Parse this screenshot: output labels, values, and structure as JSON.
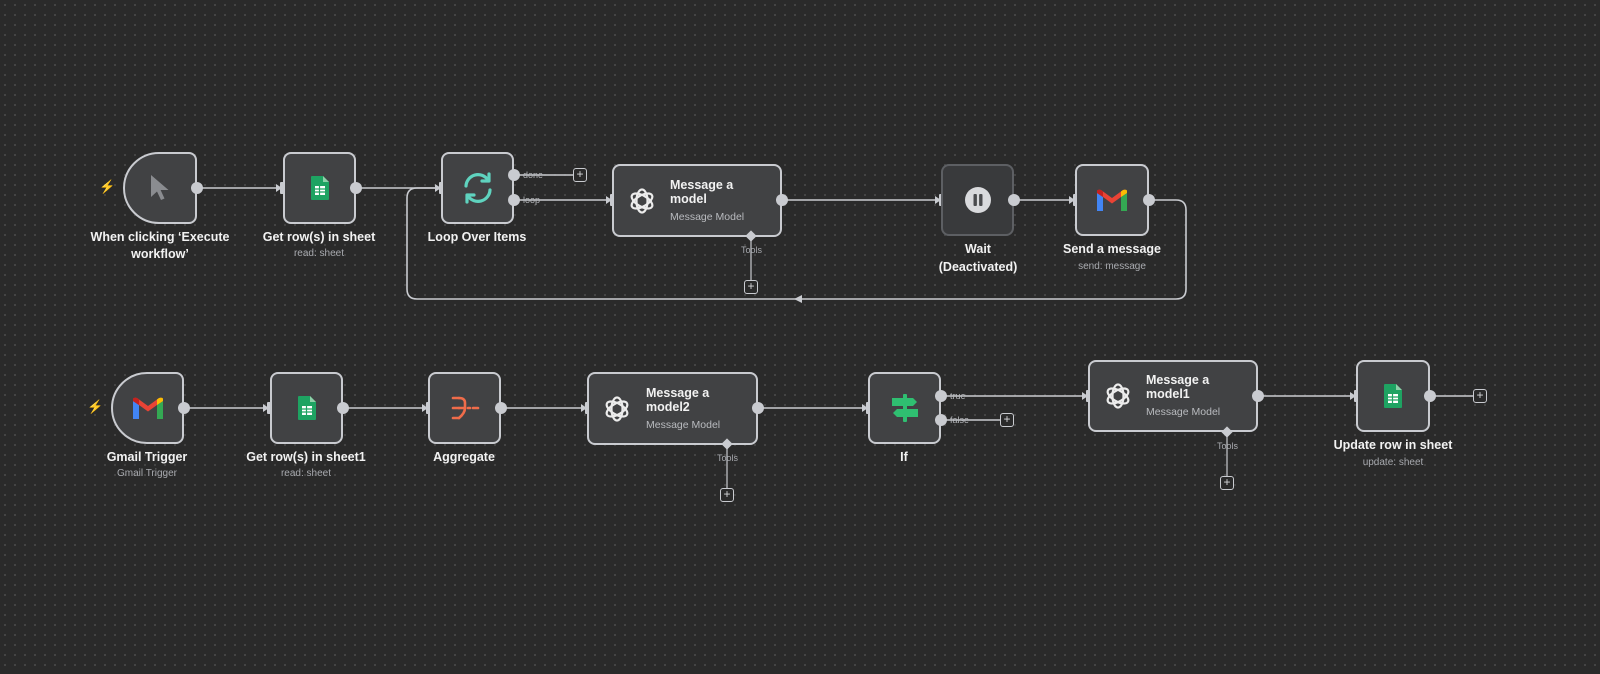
{
  "colors": {
    "canvas": "#2a2a2a",
    "node_fill": "#414244",
    "node_border": "#c9cbd0",
    "sheets_green": "#0f9d58",
    "loop_teal": "#5fd3bf",
    "aggregate_orange": "#ef6c4a",
    "if_green": "#2fbf71",
    "trigger_red": "#f0564a"
  },
  "workflow1": {
    "trigger": {
      "label": "When clicking ‘Execute workflow’",
      "icon": "cursor-pointer-icon"
    },
    "get_rows": {
      "label": "Get row(s) in sheet",
      "sublabel": "read: sheet",
      "icon": "google-sheets-icon"
    },
    "loop": {
      "label": "Loop Over Items",
      "icon": "loop-arrows-icon",
      "out_done": "done",
      "out_loop": "loop"
    },
    "message_model": {
      "title": "Message a model",
      "subtitle": "Message Model",
      "tools": "Tools",
      "icon": "openai-icon"
    },
    "wait": {
      "label_line1": "Wait",
      "label_line2": "(Deactivated)",
      "icon": "pause-icon"
    },
    "send_message": {
      "label": "Send a message",
      "sublabel": "send: message",
      "icon": "gmail-icon"
    }
  },
  "workflow2": {
    "gmail_trigger": {
      "label": "Gmail Trigger",
      "sublabel": "Gmail Trigger",
      "icon": "gmail-icon"
    },
    "get_rows1": {
      "label": "Get row(s) in sheet1",
      "sublabel": "read: sheet",
      "icon": "google-sheets-icon"
    },
    "aggregate": {
      "label": "Aggregate",
      "icon": "aggregate-icon"
    },
    "message_model2": {
      "title": "Message a model2",
      "subtitle": "Message Model",
      "tools": "Tools",
      "icon": "openai-icon"
    },
    "if_node": {
      "label": "If",
      "icon": "signpost-icon",
      "out_true": "true",
      "out_false": "false"
    },
    "message_model1": {
      "title": "Message a model1",
      "subtitle": "Message Model",
      "tools": "Tools",
      "icon": "openai-icon"
    },
    "update_row": {
      "label": "Update row in sheet",
      "sublabel": "update: sheet",
      "icon": "google-sheets-icon"
    }
  },
  "plus_symbol": "+",
  "bolt_symbol": "⚡"
}
